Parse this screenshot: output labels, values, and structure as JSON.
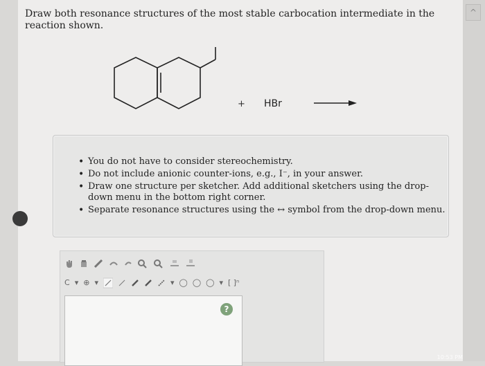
{
  "question": {
    "text": "Draw both resonance structures of the most stable carbocation intermediate in the reaction shown."
  },
  "reaction": {
    "plus": "+",
    "reagent": "HBr",
    "arrow_icon": "right-arrow-icon"
  },
  "instructions": [
    "You do not have to consider stereochemistry.",
    "Do not include anionic counter-ions, e.g., I⁻, in your answer.",
    "Draw one structure per sketcher. Add additional sketchers using the drop-down menu in the bottom right corner.",
    "Separate resonance structures using the ↔ symbol from the drop-down menu."
  ],
  "sketcher": {
    "row1_icons": [
      "hand-icon",
      "eraser-icon",
      "pencil-icon",
      "undo-icon",
      "redo-icon",
      "zoom-in-icon",
      "zoom-out-icon",
      "clean-icon",
      "template-icon"
    ],
    "row2_labels": {
      "atom": "C",
      "charge": "⊕",
      "caret": "▾",
      "ring": "◯",
      "bracket": "[ ]ⁿ"
    },
    "help": "?"
  },
  "clock": "10:53 PM"
}
